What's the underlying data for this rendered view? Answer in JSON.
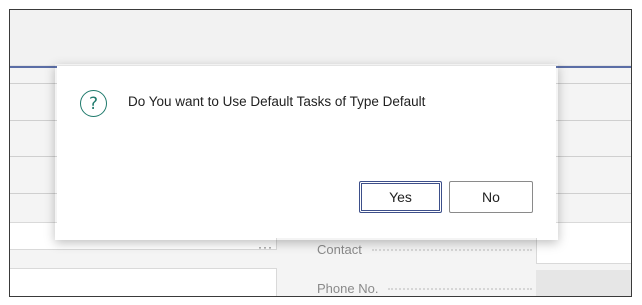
{
  "dialog": {
    "icon": "question-circle-icon",
    "message": "Do You want to Use Default Tasks of Type Default",
    "yes_label": "Yes",
    "no_label": "No"
  },
  "background_form": {
    "ellipsis": "···",
    "fields": [
      {
        "label": "Contact"
      },
      {
        "label": "Phone No."
      }
    ]
  },
  "colors": {
    "accent": "#1f7a6c",
    "primary_button_border": "#3d4f8a",
    "header_line": "#5b6ea6"
  }
}
